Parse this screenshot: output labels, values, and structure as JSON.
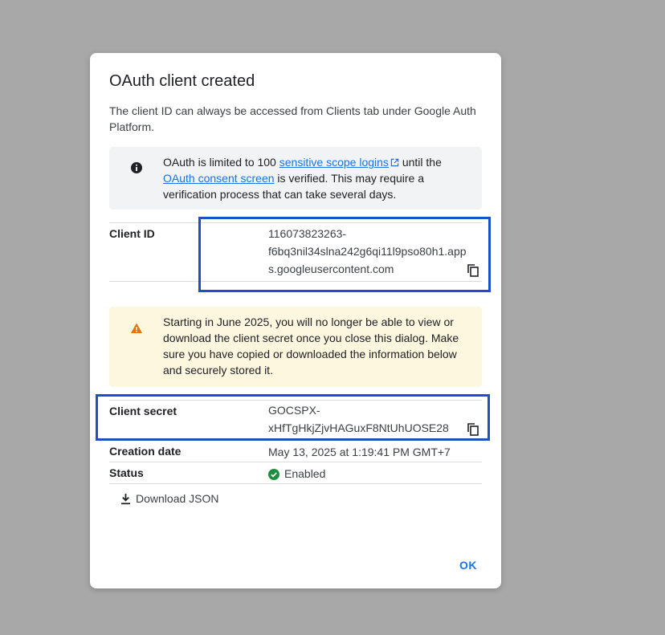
{
  "dialog": {
    "title": "OAuth client created",
    "intro": "The client ID can always be accessed from Clients tab under Google Auth Platform.",
    "info_notice": {
      "icon": "info-icon",
      "text_before": "OAuth is limited to 100 ",
      "link1": "sensitive scope logins",
      "text_mid": " until the ",
      "link2": "OAuth consent screen",
      "text_after": " is verified. This may require a verification process that can take several days."
    },
    "client_id": {
      "label": "Client ID",
      "line1": "116073823263-",
      "line2": "f6bq3nil34slna242g6qi11l9pso80h1.app",
      "line3": "s.googleusercontent.com"
    },
    "warning_notice": {
      "icon": "warning-icon",
      "text": "Starting in June 2025, you will no longer be able to view or download the client secret once you close this dialog. Make sure you have copied or downloaded the information below and securely stored it."
    },
    "client_secret": {
      "label": "Client secret",
      "line1": "GOCSPX-",
      "line2": "xHfTgHkjZjvHAGuxF8NtUhUOSE28"
    },
    "creation_date": {
      "label": "Creation date",
      "value": "May 13, 2025 at 1:19:41 PM GMT+7"
    },
    "status": {
      "label": "Status",
      "value": "Enabled",
      "icon": "check-circle-icon",
      "color": "#1e8e3e"
    },
    "download_label": "Download JSON",
    "ok_label": "OK"
  },
  "colors": {
    "accent": "#1a73e8",
    "highlight_box": "#1f4fc8",
    "warning": "#e37400",
    "info_bg": "#f1f3f4",
    "warning_bg": "#fef7e0"
  }
}
